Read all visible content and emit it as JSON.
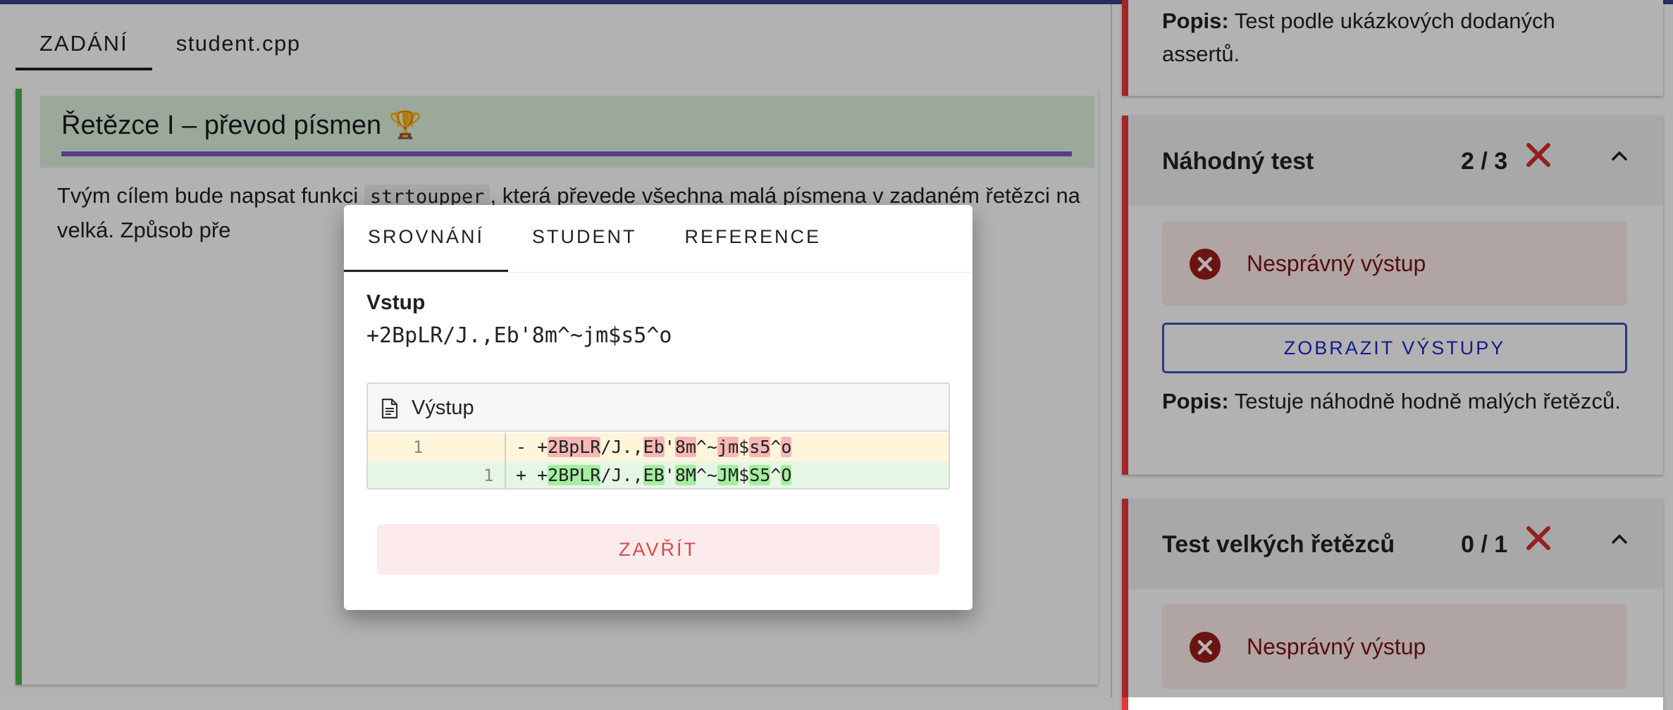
{
  "left": {
    "tabs": [
      {
        "label": "ZADÁNÍ",
        "active": true
      },
      {
        "label": "student.cpp",
        "active": false
      }
    ],
    "assignment": {
      "title": "Řetězce I – převod písmen 🏆",
      "para_before": "Tvým cílem bude napsat funkci ",
      "code": "strtoupper",
      "para_after": ", která převede všechna malá písmena v zadaném řetězci na velká. Způsob pře"
    }
  },
  "right": {
    "top_card": {
      "popis_label": "Popis:",
      "popis_text": " Test podle ukázkových dodaných assertů."
    },
    "random_test": {
      "name": "Náhodný test",
      "score": "2 / 3",
      "alert": "Nesprávný výstup",
      "button": "ZOBRAZIT VÝSTUPY",
      "popis_label": "Popis:",
      "popis_text": " Testuje náhodně hodně malých řetězců."
    },
    "big_test": {
      "name": "Test velkých řetězců",
      "score": "0 / 1",
      "alert": "Nesprávný výstup"
    }
  },
  "modal": {
    "tabs": [
      {
        "label": "SROVNÁNÍ",
        "active": true
      },
      {
        "label": "STUDENT",
        "active": false
      },
      {
        "label": "REFERENCE",
        "active": false
      }
    ],
    "input_label": "Vstup",
    "input_value": "+2BpLR/J.,Eb'8m^~jm$s5^o",
    "diff_title": "Výstup",
    "diff": {
      "removed_line_no": "1",
      "added_line_no": "1",
      "removed_prefix": "- +",
      "added_prefix": "+ +",
      "removed_segments": [
        {
          "t": "2BpLR",
          "hl": true
        },
        {
          "t": "/J.,",
          "hl": false
        },
        {
          "t": "Eb",
          "hl": true
        },
        {
          "t": "'",
          "hl": false
        },
        {
          "t": "8m",
          "hl": true
        },
        {
          "t": "^~",
          "hl": false
        },
        {
          "t": "jm",
          "hl": true
        },
        {
          "t": "$",
          "hl": false
        },
        {
          "t": "s5",
          "hl": true
        },
        {
          "t": "^",
          "hl": false
        },
        {
          "t": "o",
          "hl": true
        }
      ],
      "added_segments": [
        {
          "t": "2BPLR",
          "hl": true
        },
        {
          "t": "/J.,",
          "hl": false
        },
        {
          "t": "EB",
          "hl": true
        },
        {
          "t": "'",
          "hl": false
        },
        {
          "t": "8M",
          "hl": true
        },
        {
          "t": "^~",
          "hl": false
        },
        {
          "t": "JM",
          "hl": true
        },
        {
          "t": "$",
          "hl": false
        },
        {
          "t": "S5",
          "hl": true
        },
        {
          "t": "^",
          "hl": false
        },
        {
          "t": "O",
          "hl": true
        }
      ]
    },
    "close_label": "ZAVŘÍT"
  },
  "colors": {
    "accent_green": "#4caf50",
    "accent_red": "#e53935",
    "accent_purple": "#7e57c2",
    "primary_blue": "#3f51b5"
  }
}
